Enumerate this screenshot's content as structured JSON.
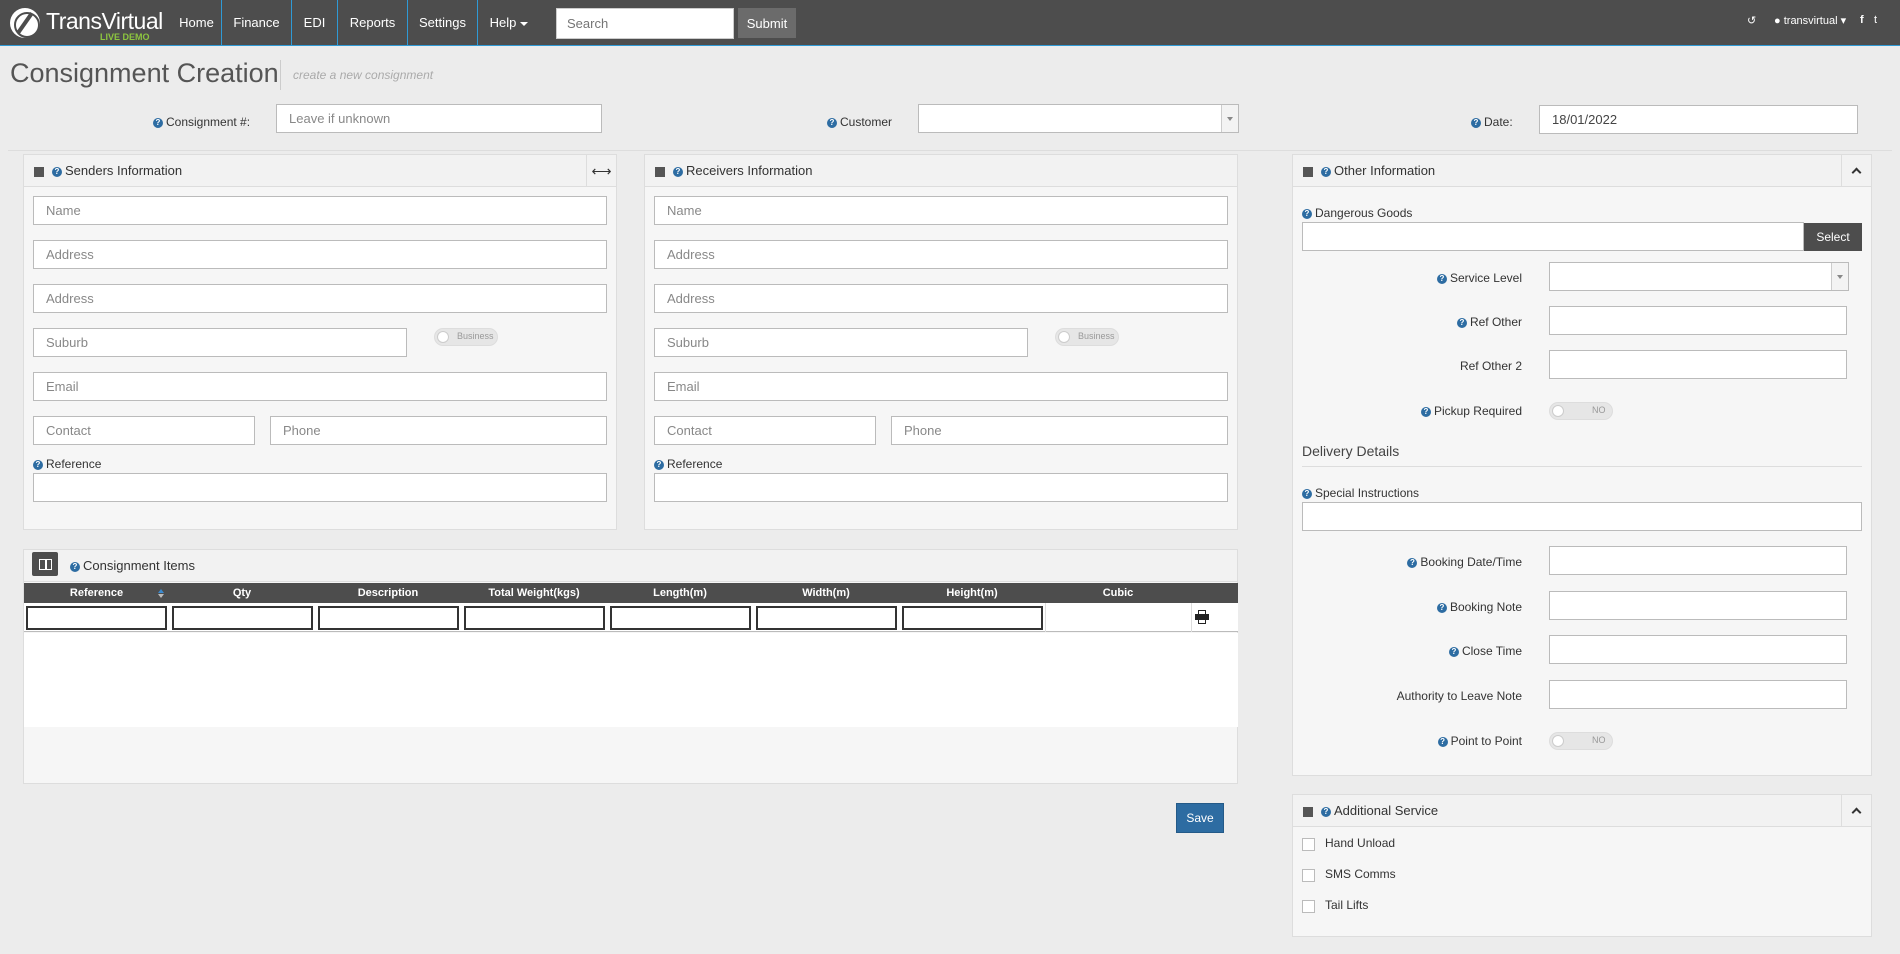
{
  "nav": {
    "brand": "TransVirtual",
    "brand_sub": "LIVE DEMO",
    "items": [
      "Home",
      "Finance",
      "EDI",
      "Reports",
      "Settings",
      "Help"
    ],
    "search_placeholder": "Search",
    "submit_label": "Submit",
    "user": "transvirtual"
  },
  "page": {
    "title": "Consignment Creation",
    "subtitle": "create a new consignment"
  },
  "topform": {
    "consignment_label": "Consignment #:",
    "consignment_placeholder": "Leave if unknown",
    "customer_label": "Customer",
    "customer_value": "",
    "date_label": "Date:",
    "date_value": "18/01/2022"
  },
  "senders": {
    "title": "Senders Information",
    "name": "Name",
    "address1": "Address",
    "address2": "Address",
    "suburb": "Suburb",
    "business_toggle": "Business",
    "email": "Email",
    "contact": "Contact",
    "phone": "Phone",
    "reference_label": "Reference"
  },
  "receivers": {
    "title": "Receivers Information",
    "name": "Name",
    "address1": "Address",
    "address2": "Address",
    "suburb": "Suburb",
    "business_toggle": "Business",
    "email": "Email",
    "contact": "Contact",
    "phone": "Phone",
    "reference_label": "Reference"
  },
  "items": {
    "title": "Consignment Items",
    "columns": [
      "Reference",
      "Qty",
      "Description",
      "Total Weight(kgs)",
      "Length(m)",
      "Width(m)",
      "Height(m)",
      "Cubic"
    ]
  },
  "save_label": "Save",
  "other": {
    "title": "Other Information",
    "dangerous_goods_label": "Dangerous Goods",
    "select_label": "Select",
    "service_level_label": "Service Level",
    "ref_other_label": "Ref Other",
    "ref_other2_label": "Ref Other 2",
    "pickup_required_label": "Pickup Required",
    "pickup_toggle": "NO",
    "delivery_details_title": "Delivery Details",
    "special_instructions_label": "Special Instructions",
    "booking_datetime_label": "Booking Date/Time",
    "booking_note_label": "Booking Note",
    "close_time_label": "Close Time",
    "authority_label": "Authority to Leave Note",
    "point_to_point_label": "Point to Point",
    "point_toggle": "NO"
  },
  "additional": {
    "title": "Additional Service",
    "options": [
      "Hand Unload",
      "SMS Comms",
      "Tail Lifts"
    ]
  }
}
